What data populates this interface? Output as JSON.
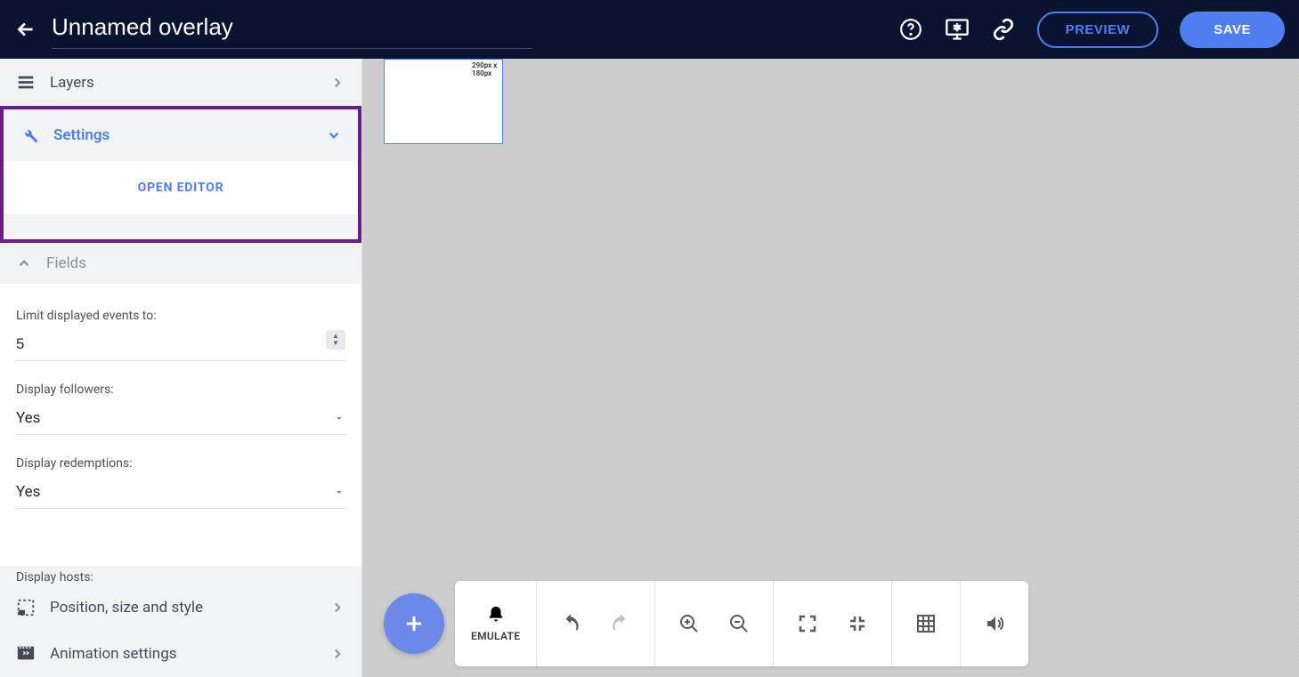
{
  "header": {
    "title": "Unnamed overlay",
    "preview_label": "PREVIEW",
    "save_label": "SAVE"
  },
  "sidebar": {
    "layers_label": "Layers",
    "settings_label": "Settings",
    "open_editor_label": "OPEN EDITOR",
    "fields_label": "Fields",
    "position_label": "Position, size and style",
    "animation_label": "Animation settings"
  },
  "fields": {
    "limit_label": "Limit displayed events to:",
    "limit_value": "5",
    "followers_label": "Display followers:",
    "followers_value": "Yes",
    "redemptions_label": "Display redemptions:",
    "redemptions_value": "Yes",
    "hosts_label": "Display hosts:"
  },
  "canvas": {
    "dims_label": "290px x 180px"
  },
  "toolbar": {
    "emulate_label": "EMULATE"
  }
}
